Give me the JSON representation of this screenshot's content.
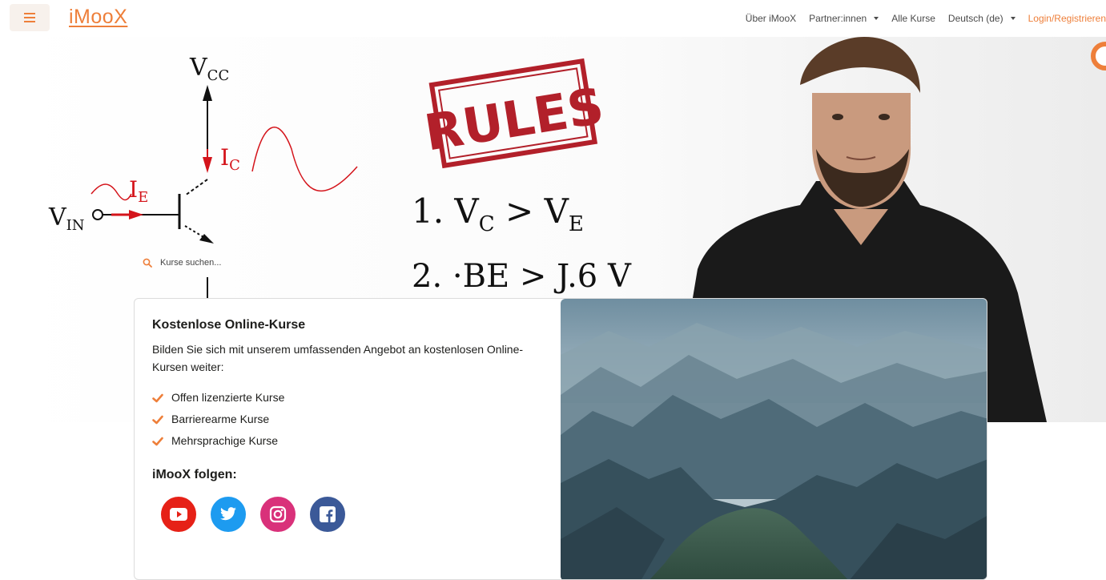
{
  "nav": {
    "logo": "iMooX",
    "links": [
      {
        "label": "Über iMooX",
        "dropdown": false
      },
      {
        "label": "Partner:innen",
        "dropdown": true
      },
      {
        "label": "Alle Kurse",
        "dropdown": false
      },
      {
        "label": "Deutsch (de)",
        "dropdown": true
      }
    ],
    "login": "Login/Registrieren"
  },
  "hero": {
    "rules_stamp": "RULES",
    "rule1": "1. V",
    "rule1_sub_a": "C",
    "rule1_gt": " > V",
    "rule1_sub_b": "E",
    "rule2_fragment": "2.  ·BE  >  J.6 V",
    "label_vcc": "V",
    "label_vcc_sub": "CC",
    "label_ic": "I",
    "label_ic_sub": "C",
    "label_ie": "I",
    "label_ie_sub": "E",
    "label_vin": "V",
    "label_vin_sub": "IN"
  },
  "search": {
    "placeholder": "Kurse suchen..."
  },
  "card": {
    "title": "Kostenlose Online-Kurse",
    "description": "Bilden Sie sich mit unserem umfassenden Angebot an kostenlosen Online-Kursen weiter:",
    "features": [
      "Offen lizenzierte Kurse",
      "Barrierearme Kurse",
      "Mehrsprachige Kurse"
    ],
    "follow_title": "iMooX folgen:",
    "social": [
      "youtube-icon",
      "twitter-icon",
      "instagram-icon",
      "facebook-icon"
    ]
  },
  "colors": {
    "accent": "#ee7f3a",
    "youtube": "#e62117",
    "twitter": "#1d9bf0",
    "instagram": "#d9317a",
    "facebook": "#3b5998",
    "stamp": "#b2202a"
  }
}
